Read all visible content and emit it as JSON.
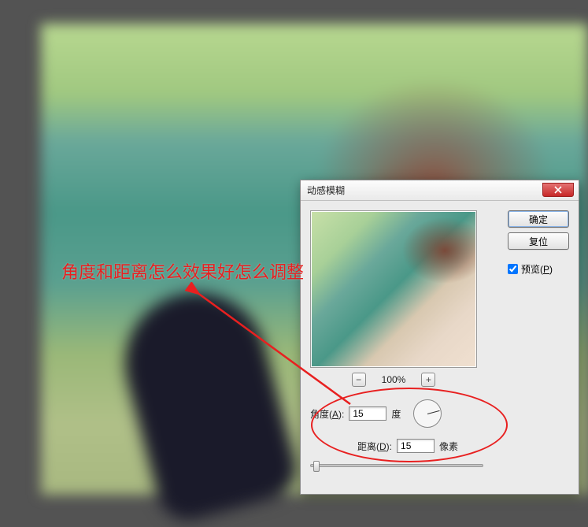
{
  "annotation": {
    "text": "角度和距离怎么效果好怎么调整"
  },
  "dialog": {
    "title": "动感模糊",
    "buttons": {
      "ok": "确定",
      "reset": "复位"
    },
    "preview_checkbox": {
      "label": "预览(",
      "key": "P",
      "suffix": ")",
      "checked": true
    },
    "zoom": {
      "minus": "−",
      "plus": "+",
      "level": "100%"
    },
    "angle": {
      "label_prefix": "角度(",
      "key": "A",
      "label_suffix": "):",
      "value": "15",
      "unit": "度"
    },
    "distance": {
      "label_prefix": "距离(",
      "key": "D",
      "label_suffix": "):",
      "value": "15",
      "unit": "像素"
    }
  }
}
